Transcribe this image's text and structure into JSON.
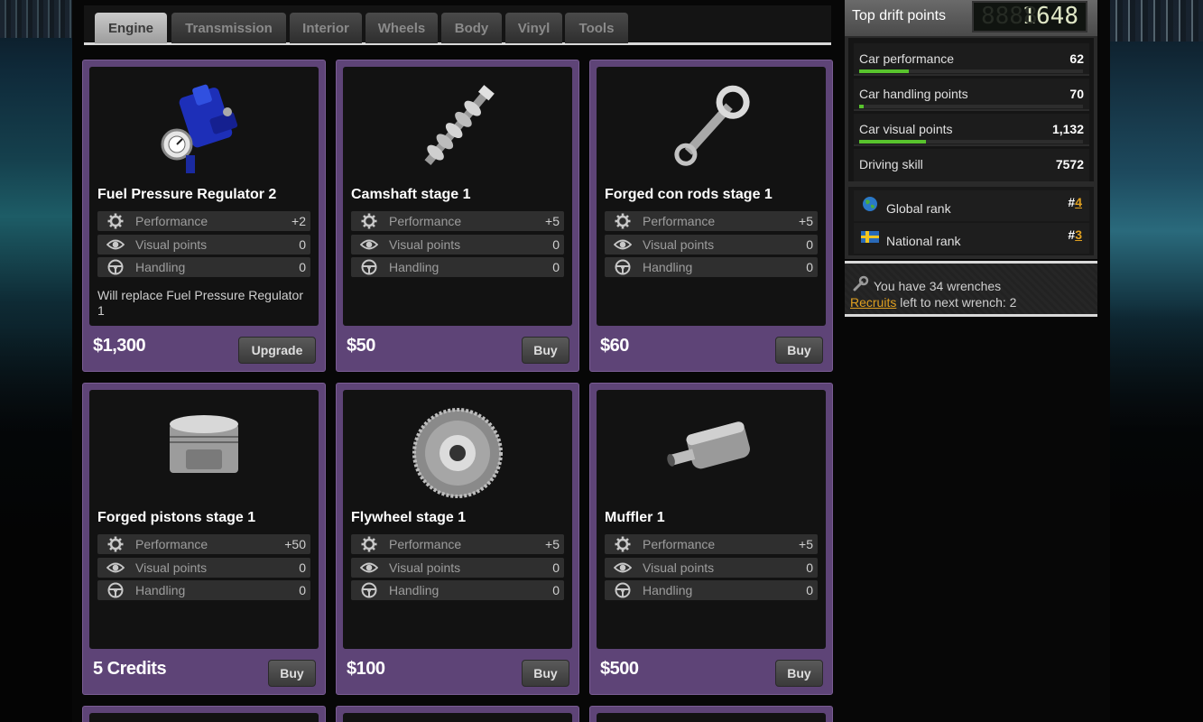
{
  "tabs": [
    "Engine",
    "Transmission",
    "Interior",
    "Wheels",
    "Body",
    "Vinyl",
    "Tools"
  ],
  "active_tab": "Engine",
  "stat_labels": {
    "performance": "Performance",
    "visual": "Visual points",
    "handling": "Handling"
  },
  "parts": [
    {
      "name": "Fuel Pressure Regulator 2",
      "performance": "+2",
      "visual": "0",
      "handling": "0",
      "note": "Will replace Fuel Pressure Regulator 1",
      "price": "$1,300",
      "button": "Upgrade",
      "icon": "fuel-pressure-regulator-icon"
    },
    {
      "name": "Camshaft stage 1",
      "performance": "+5",
      "visual": "0",
      "handling": "0",
      "note": "",
      "price": "$50",
      "button": "Buy",
      "icon": "camshaft-icon"
    },
    {
      "name": "Forged con rods stage 1",
      "performance": "+5",
      "visual": "0",
      "handling": "0",
      "note": "",
      "price": "$60",
      "button": "Buy",
      "icon": "con-rod-icon"
    },
    {
      "name": "Forged pistons stage 1",
      "performance": "+50",
      "visual": "0",
      "handling": "0",
      "note": "",
      "price": "5 Credits",
      "button": "Buy",
      "icon": "piston-icon"
    },
    {
      "name": "Flywheel stage 1",
      "performance": "+5",
      "visual": "0",
      "handling": "0",
      "note": "",
      "price": "$100",
      "button": "Buy",
      "icon": "flywheel-icon"
    },
    {
      "name": "Muffler 1",
      "performance": "+5",
      "visual": "0",
      "handling": "0",
      "note": "",
      "price": "$500",
      "button": "Buy",
      "icon": "muffler-icon"
    }
  ],
  "sidebar": {
    "title": "Top drift points",
    "counter": "1648",
    "counter_ghost": "8888",
    "stats": [
      {
        "label": "Car performance",
        "value": "62",
        "level": 0.22
      },
      {
        "label": "Car handling points",
        "value": "70",
        "level": 0.02
      },
      {
        "label": "Car visual points",
        "value": "1,132",
        "level": 0.3
      },
      {
        "label": "Driving skill",
        "value": "7572",
        "level": 0
      }
    ],
    "ranks": [
      {
        "label": "Global rank",
        "prefix": "#",
        "value": "4",
        "icon": "globe-icon"
      },
      {
        "label": "National rank",
        "prefix": "#",
        "value": "3",
        "icon": "swedish-flag-icon"
      }
    ],
    "wrenches_text": "You have 34 wrenches",
    "recruits_link": "Recruits",
    "recruits_text": " left to next wrench: 2"
  },
  "colors": {
    "card_border": "#5e4477",
    "stat_bar": "#58c32d",
    "rank_highlight": "#e0a020"
  }
}
